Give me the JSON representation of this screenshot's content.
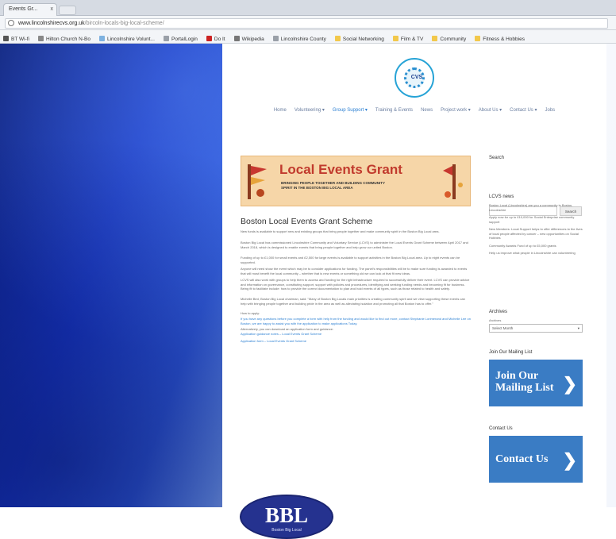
{
  "browser": {
    "tab_title": "Events Gr...",
    "tab_close": "x",
    "url_host": "www.lincolnshirecvs.org.uk",
    "url_path": "/bircoln-locals-big-local-scheme/",
    "bookmarks": [
      {
        "label": "BT Wi-fi",
        "color": "#555555"
      },
      {
        "label": "Hilton Church N-Bo",
        "color": "#888888"
      },
      {
        "label": "Lincolnshire Volunt...",
        "color": "#7fb2e0"
      },
      {
        "label": "PortalLogin",
        "color": "#9aa0a8"
      },
      {
        "label": "Do It",
        "color": "#cc2222"
      },
      {
        "label": "Wikipedia",
        "color": "#777777"
      },
      {
        "label": "Lincolnshire County",
        "color": "#9aa0a8"
      },
      {
        "label": "Social Networking",
        "color": "#f2c84b"
      },
      {
        "label": "Film & TV",
        "color": "#f2c84b"
      },
      {
        "label": "Community",
        "color": "#f2c84b"
      },
      {
        "label": "Fitness & Hobbies",
        "color": "#f2c84b"
      }
    ]
  },
  "site": {
    "logo_text": "CVS",
    "nav": [
      "Home",
      "Volunteering ▾",
      "Group Support ▾",
      "Training & Events",
      "News",
      "Project work ▾",
      "About Us ▾",
      "Contact Us ▾",
      "Jobs"
    ],
    "nav_active_index": 2
  },
  "article": {
    "banner_title": "Local Events Grant",
    "banner_subtitle": "BRINGING PEOPLE TOGETHER AND BUILDING COMMUNITY SPIRIT IN THE BOSTON BIG LOCAL AREA",
    "title": "Boston Local Events Grant Scheme",
    "paragraphs": [
      "New funds is available to support new and existing groups that bring people together and make community spirit in the Boston Big Local area.",
      "Boston Big Local has commissioned Lincolnshire Community and Voluntary Service (LCVS) to administer the Local Events Grant Scheme between April 2017 and March 2018, which is designed to enable events that bring people together and help grow our united Boston.",
      "Funding of up to £1,000 for small events and £2,500 for large events is available to support activities in the Boston Big Local area. Up to eight events can be supported.",
      "Anyone will need show the event which may be to consider applications for funding. The panel's responsibilities will be to make sure funding is awarded to events that will most benefit the local community – whether that is new events or something old we can look at that fit new ideas.",
      "LCVS will also work with groups to help them to access and funding for the right infrastructure required to successfully deliver their event. LCVS can provide advice and information on governance, constituting support, support with policies and procedures, identifying and seeking funding needs and becoming fit for business. Being fit to facilitate include: how to provide the correct documentation to plan and hold events of all types, such as those related to health and safety.",
      "Michelle Bird, Boston Big Local chairman, said: \"Many of Boston Big Locals main priorities is creating community spirit and we view supporting these events can help with bringing people together and building pride in the area as well as alleviating isolation and promoting all that Boston has to offer.\"",
      "How to apply:",
      "If you have any questions before you complete a form with help from the funding and would like to find out more, contact Stephanie Lorimerand and Michelle Lee on Boston, we are happy to assist you with the application to make applications Today.",
      "Alternatively, you can download an application form and guidance:",
      "Application guidance notes – Local Events Grant Scheme",
      "Application form – Local Events Grant Scheme"
    ],
    "bbl_letters": "BBL",
    "bbl_caption": "Boston Big Local"
  },
  "sidebar": {
    "search_heading": "Search",
    "search_placeholder": "",
    "search_button": "Search",
    "news_heading": "LCVS news",
    "news_items": [
      "Boston Local (Lincolnshire) are you a community in Boston, Lincolnshire",
      "Apply now for up to £10,000 for Social Enterprise community support",
      "New Members: Local Support helps to offer differences to the lives of local people affected by cancer – new opportunities on Social Hobbies",
      "Community Awards Fund of up to £5,000 grants",
      "Help us improve what people in Lincolnshire can volunteering"
    ],
    "archives_heading": "Archives",
    "archives_label": "Archives",
    "archives_select": "Select Month",
    "mailing_heading": "Join Our Mailing List",
    "mailing_cta": "Join Our Mailing List",
    "contact_heading": "Contact Us",
    "contact_cta": "Contact Us",
    "cta_color": "#3a7cc4"
  }
}
